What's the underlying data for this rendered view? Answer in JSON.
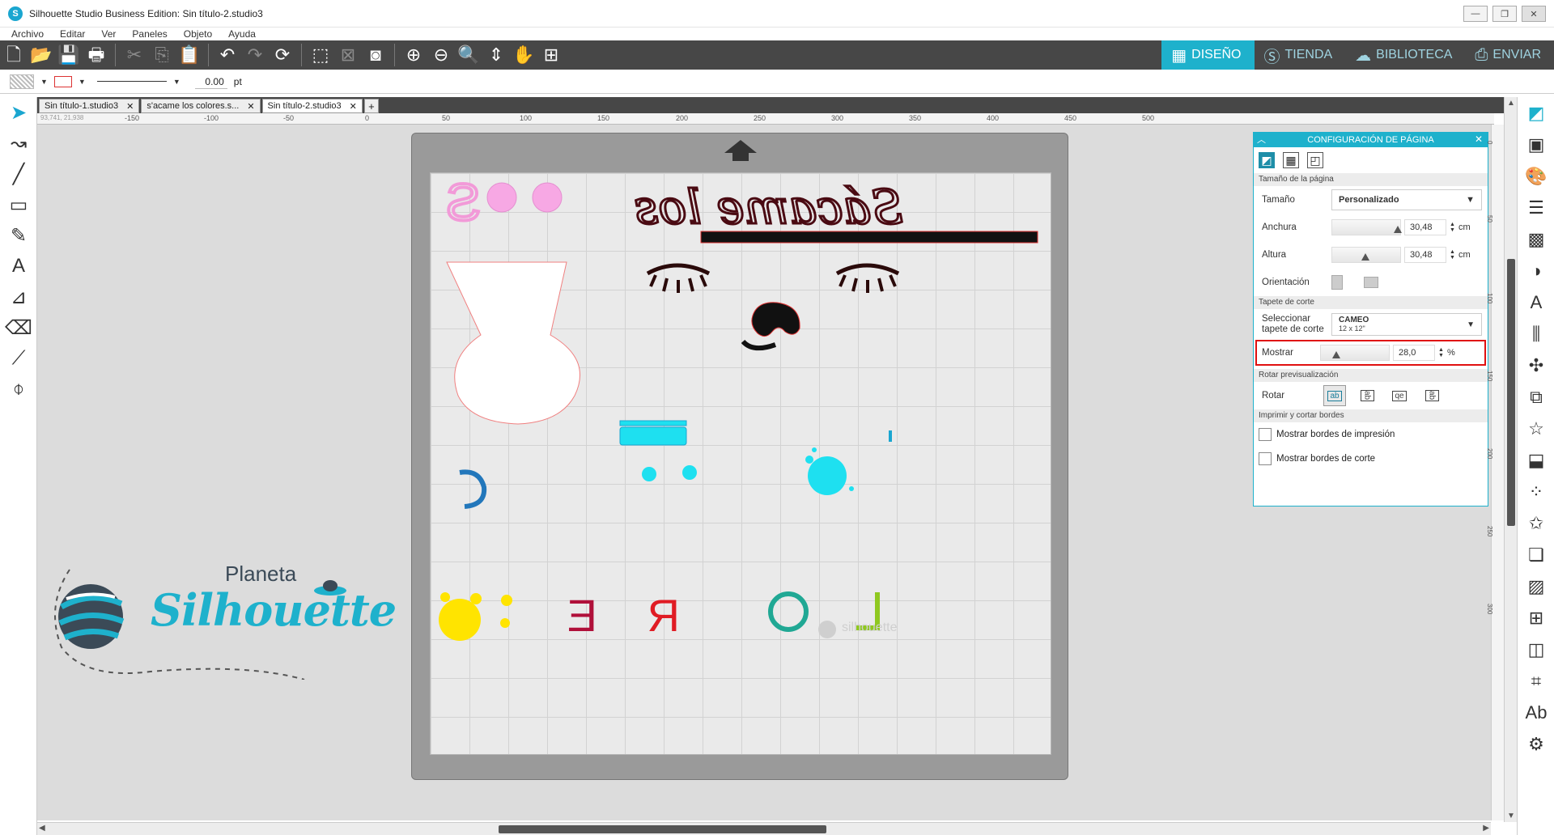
{
  "window": {
    "title": "Silhouette Studio Business Edition: Sin título-2.studio3",
    "min": "—",
    "max": "❐",
    "close": "✕"
  },
  "menu": [
    "Archivo",
    "Editar",
    "Ver",
    "Paneles",
    "Objeto",
    "Ayuda"
  ],
  "nav_tabs": [
    {
      "label": "DISEÑO",
      "active": true
    },
    {
      "label": "TIENDA",
      "active": false
    },
    {
      "label": "BIBLIOTECA",
      "active": false
    },
    {
      "label": "ENVIAR",
      "active": false
    }
  ],
  "properties": {
    "line_width": "0.00",
    "unit": "pt"
  },
  "doc_tabs": [
    "Sin título-1.studio3",
    "s'acame los colores.s...",
    "Sin título-2.studio3"
  ],
  "ruler": {
    "coords": "93,741, 21,938",
    "h_ticks": [
      "-150",
      "-100",
      "-50",
      "0",
      "50",
      "100",
      "150",
      "200",
      "250",
      "300",
      "350",
      "400",
      "450",
      "500"
    ],
    "v_ticks": [
      "0",
      "50",
      "100",
      "150",
      "200",
      "250",
      "300"
    ]
  },
  "canvas": {
    "text": "Sácame los",
    "watermark": "silhouette"
  },
  "panel": {
    "title": "CONFIGURACIÓN DE PÁGINA",
    "section_size": "Tamaño de la página",
    "size_label": "Tamaño",
    "size_value": "Personalizado",
    "width_label": "Anchura",
    "width_value": "30,48",
    "height_label": "Altura",
    "height_value": "30,48",
    "unit_cm": "cm",
    "orientation_label": "Orientación",
    "section_mat": "Tapete de corte",
    "mat_label_1": "Seleccionar",
    "mat_label_2": "tapete de corte",
    "mat_value": "CAMEO",
    "mat_size": "12 x 12\"",
    "show_label": "Mostrar",
    "show_value": "28,0",
    "show_unit": "%",
    "section_rotate": "Rotar previsualización",
    "rotate_label": "Rotar",
    "rotate_options": [
      "ab",
      "ab",
      "qe",
      "ab"
    ],
    "section_borders": "Imprimir y cortar bordes",
    "chk_print": "Mostrar bordes de impresión",
    "chk_cut": "Mostrar bordes de corte"
  },
  "logo": {
    "line1": "Planeta",
    "line2": "Silhouette"
  },
  "colors": {
    "accent": "#1eb1cc",
    "toolbar": "#474747",
    "highlight": "#e01010"
  }
}
